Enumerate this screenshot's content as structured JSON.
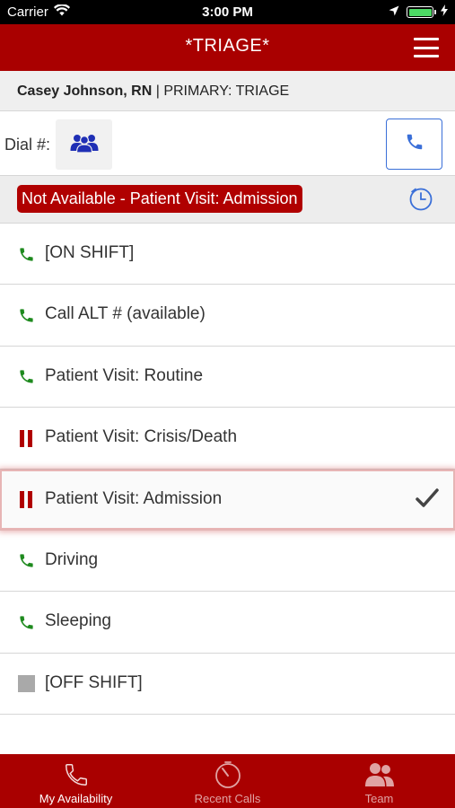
{
  "status_bar": {
    "carrier": "Carrier",
    "time": "3:00 PM"
  },
  "nav": {
    "title": "*TRIAGE*",
    "menu_icon": "hamburger-menu-icon"
  },
  "user": {
    "name": "Casey Johnson, RN",
    "separator": " | ",
    "role": "PRIMARY: TRIAGE"
  },
  "dial": {
    "label": "Dial #:",
    "group_icon": "group-icon",
    "call_icon": "phone-icon"
  },
  "current_status": {
    "label": "Not Available - Patient Visit: Admission",
    "clock_icon": "clock-icon"
  },
  "statuses": [
    {
      "label": "[ON SHIFT]",
      "icon": "phone-icon"
    },
    {
      "label": "Call ALT # (available)",
      "icon": "phone-icon"
    },
    {
      "label": "Patient Visit: Routine",
      "icon": "phone-icon"
    },
    {
      "label": "Patient Visit: Crisis/Death",
      "icon": "pause-icon"
    },
    {
      "label": "Patient Visit: Admission",
      "icon": "pause-icon",
      "selected": true
    },
    {
      "label": "Driving",
      "icon": "phone-icon"
    },
    {
      "label": "Sleeping",
      "icon": "phone-icon"
    },
    {
      "label": "[OFF SHIFT]",
      "icon": "stop-icon"
    }
  ],
  "tabs": [
    {
      "label": "My Availability",
      "icon": "phone-icon",
      "active": true
    },
    {
      "label": "Recent Calls",
      "icon": "stopwatch-icon",
      "active": false
    },
    {
      "label": "Team",
      "icon": "team-icon",
      "active": false
    }
  ],
  "colors": {
    "brand_red": "#a90000",
    "available_green": "#1e8a1e",
    "call_blue": "#3a6fd8",
    "group_blue": "#1f2fb5",
    "off_gray": "#a9a9a9"
  }
}
